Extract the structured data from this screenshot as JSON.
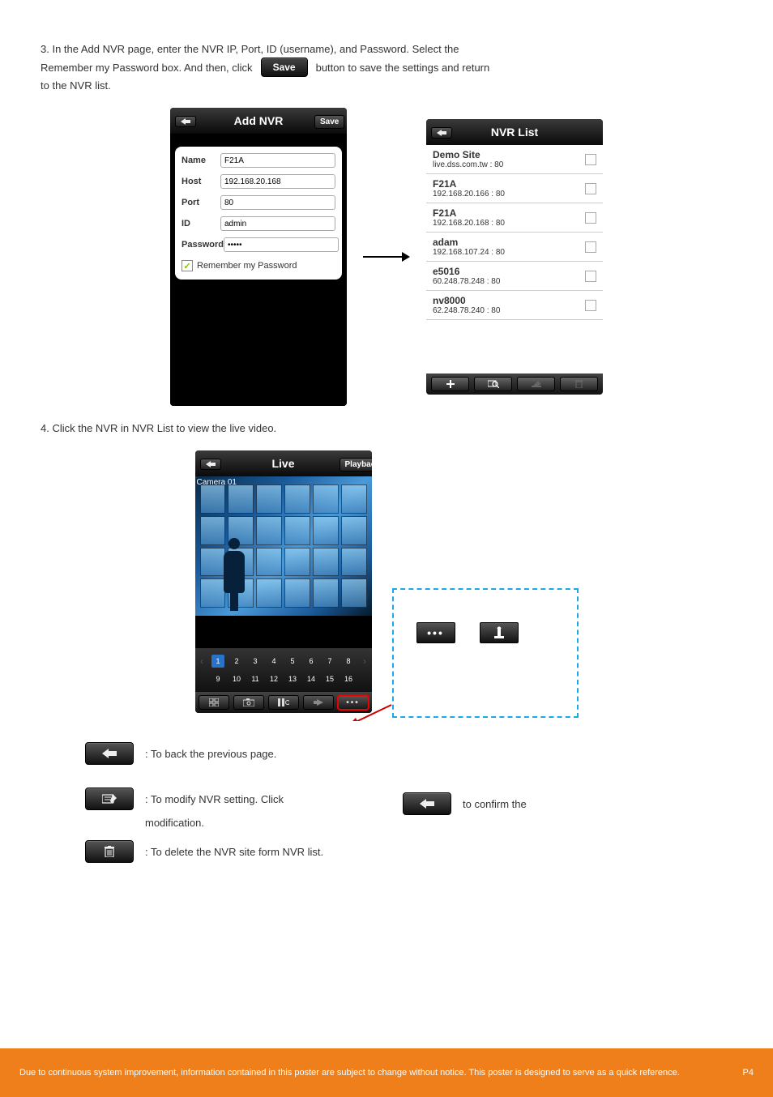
{
  "intro": {
    "line1": "3. In the Add NVR page, enter the NVR IP, Port, ID (username), and Password. Select the",
    "line2_prefix": "Remember my Password box. And then, click",
    "save_button_label": "Save",
    "line2_suffix": "button to save the settings and return",
    "line3": "to the NVR list.",
    "add_nvr": {
      "title": "Add NVR",
      "save_label": "Save",
      "fields": {
        "name_label": "Name",
        "name_value": "F21A",
        "host_label": "Host",
        "host_value": "192.168.20.168",
        "port_label": "Port",
        "port_value": "80",
        "id_label": "ID",
        "id_value": "admin",
        "password_label": "Password",
        "password_value": "•••••",
        "remember_label": "Remember my Password"
      }
    },
    "nvr_list": {
      "title": "NVR List",
      "items": [
        {
          "name": "Demo Site",
          "host": "live.dss.com.tw : 80"
        },
        {
          "name": "F21A",
          "host": "192.168.20.166 : 80"
        },
        {
          "name": "F21A",
          "host": "192.168.20.168 : 80"
        },
        {
          "name": "adam",
          "host": "192.168.107.24 : 80"
        },
        {
          "name": "e5016",
          "host": "60.248.78.248 : 80"
        },
        {
          "name": "nv8000",
          "host": "62.248.78.240 : 80"
        }
      ]
    }
  },
  "live": {
    "line": "4. Click the NVR in NVR List to view the live video.",
    "title": "Live",
    "playback_label": "Playback",
    "camera_label": "Camera 01",
    "channels_row1": [
      "1",
      "2",
      "3",
      "4",
      "5",
      "6",
      "7",
      "8"
    ],
    "channels_row2": [
      "9",
      "10",
      "11",
      "12",
      "13",
      "14",
      "15",
      "16"
    ]
  },
  "bullets": {
    "back_text": ": To back the previous page.",
    "edit_prefix": ": To modify NVR setting. Click",
    "edit_mid": "to confirm the",
    "edit_line2": "modification.",
    "delete_text": ": To delete the NVR site form NVR list."
  },
  "footer": {
    "text": "Due to continuous system improvement, information contained in this poster are subject to change without notice. This poster is designed to serve as a quick reference.",
    "page": "P4"
  }
}
